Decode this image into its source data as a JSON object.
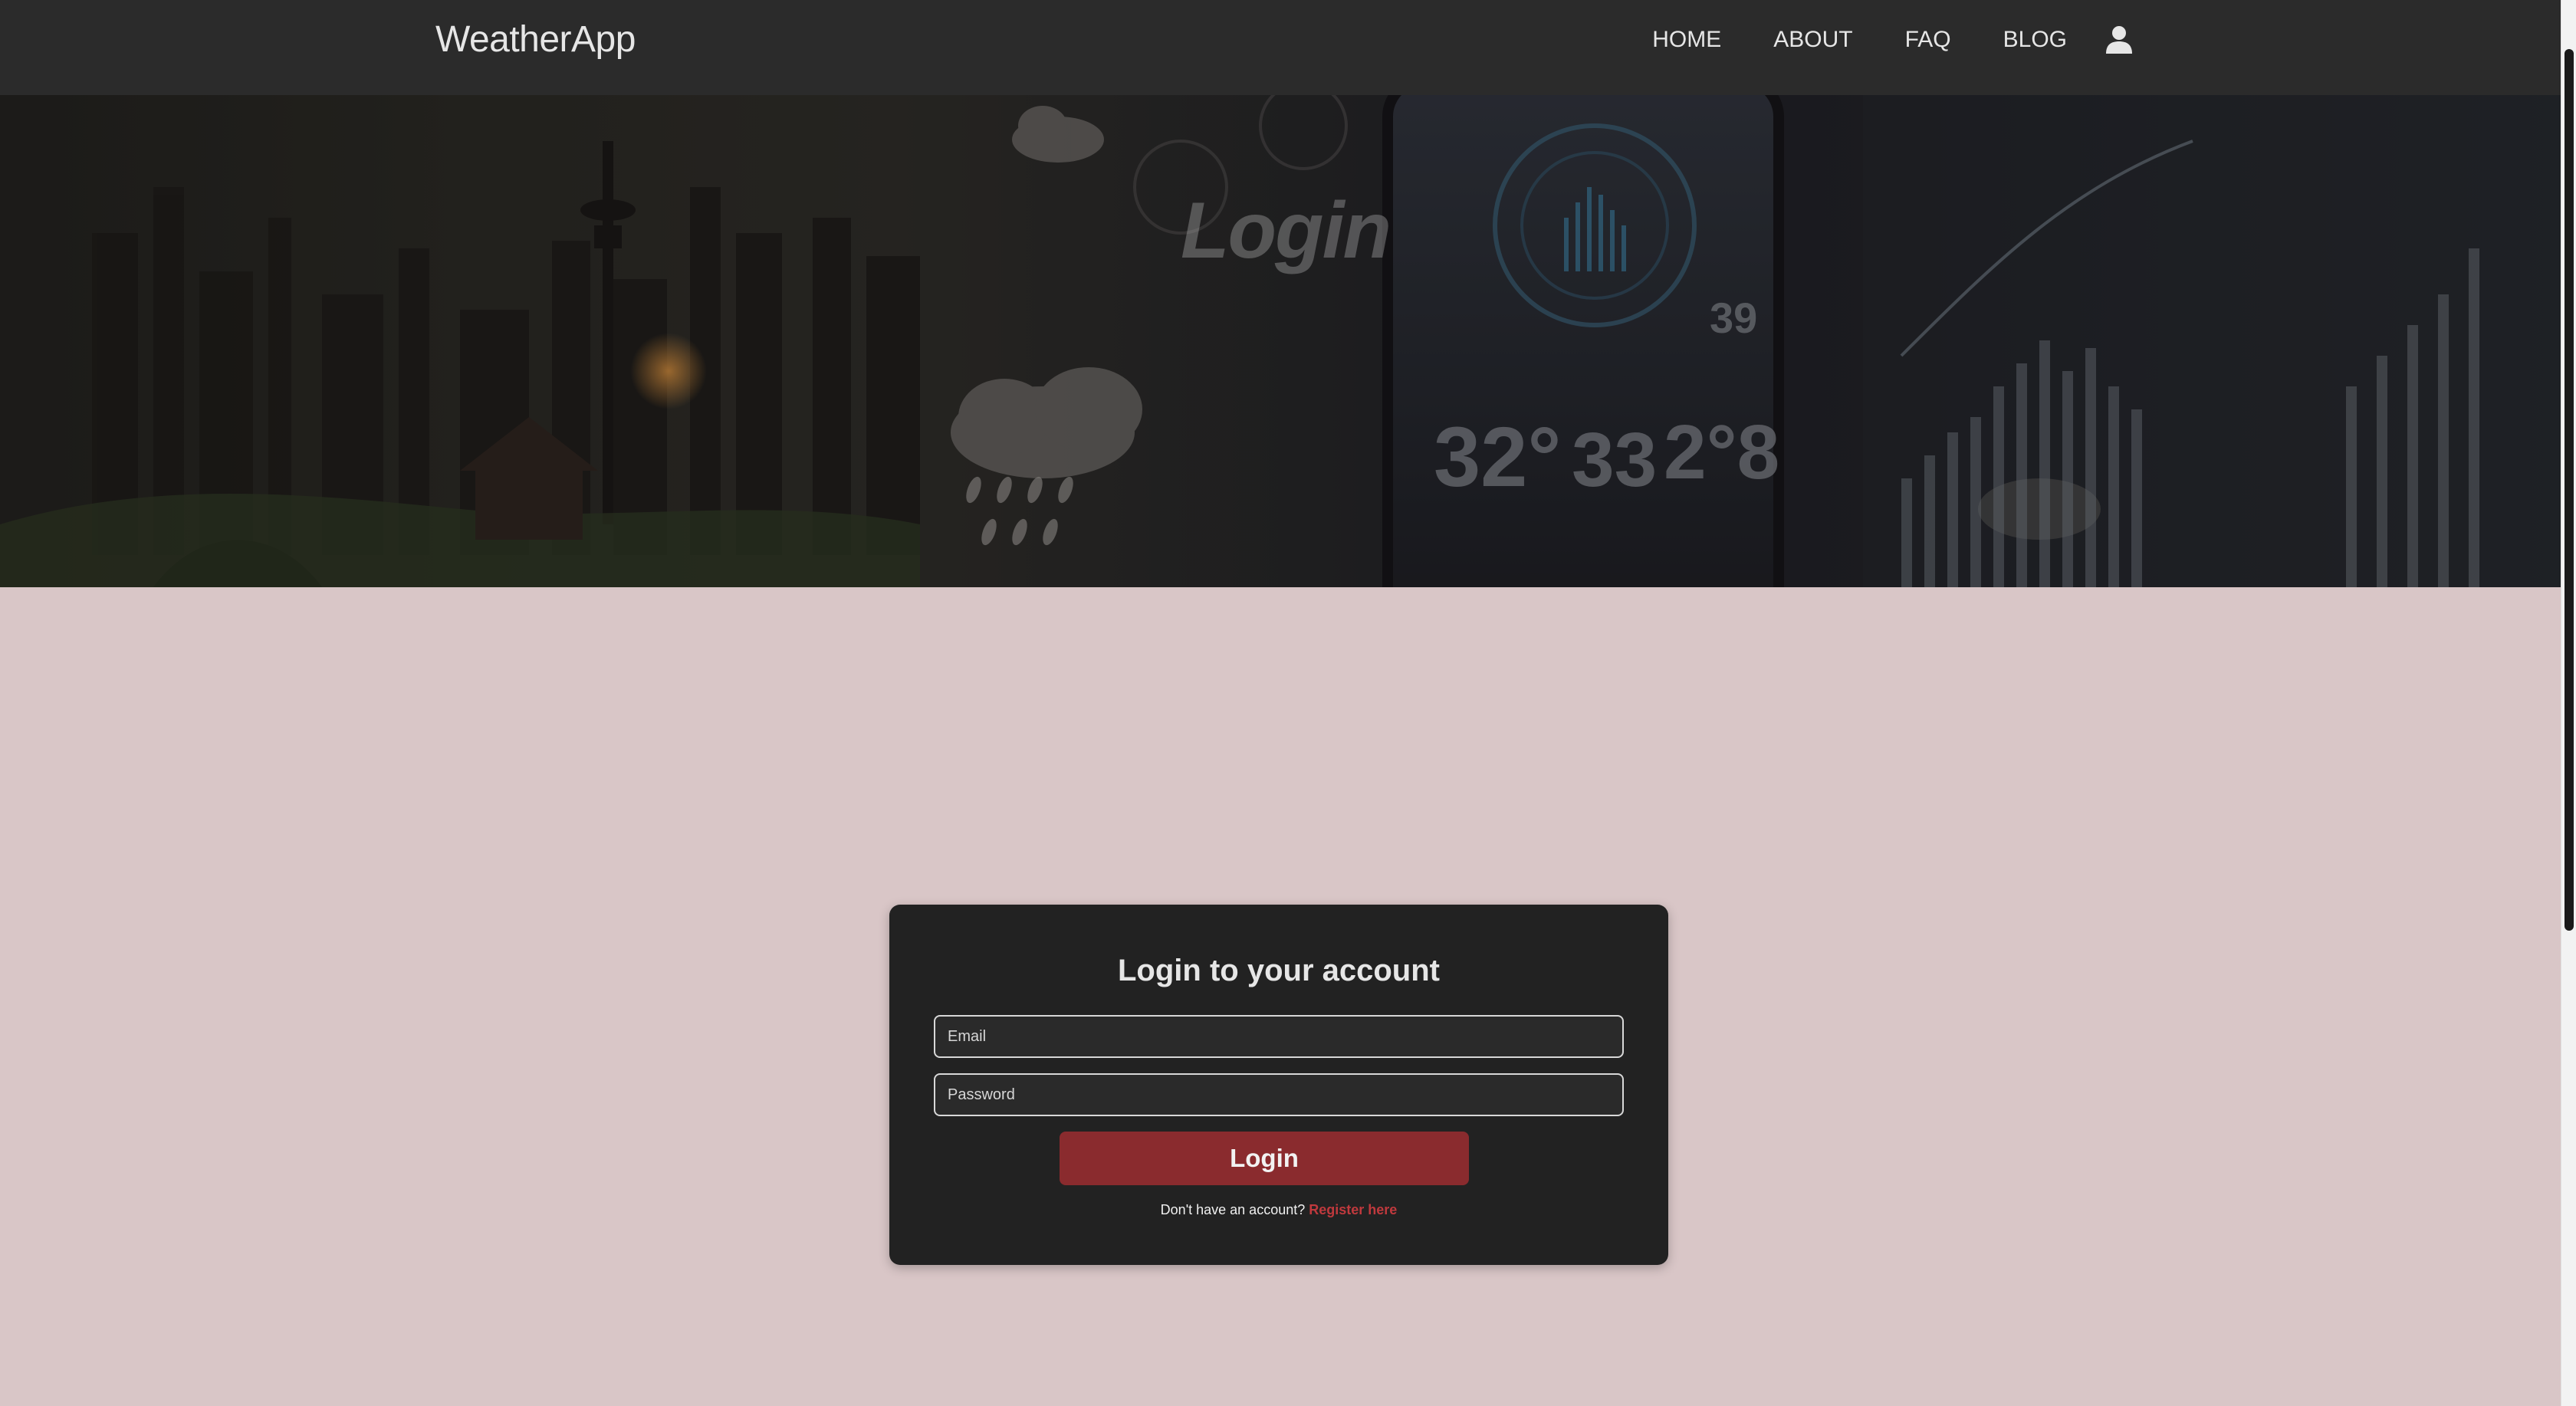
{
  "app": {
    "brand": "WeatherApp"
  },
  "nav": {
    "items": [
      {
        "label": "HOME"
      },
      {
        "label": "ABOUT"
      },
      {
        "label": "FAQ"
      },
      {
        "label": "BLOG"
      }
    ],
    "user_icon": "user-icon"
  },
  "hero": {
    "title": "Login"
  },
  "login": {
    "title": "Login to your account",
    "email_placeholder": "Email",
    "password_placeholder": "Password",
    "button_label": "Login",
    "register_prompt": "Don't have an account?",
    "register_link": "Register here"
  },
  "colors": {
    "navbar": "#2b2b2b",
    "page_background": "#d9c6c7",
    "card_background": "#222222",
    "button": "#8a2b2e",
    "link": "#c0393d"
  }
}
